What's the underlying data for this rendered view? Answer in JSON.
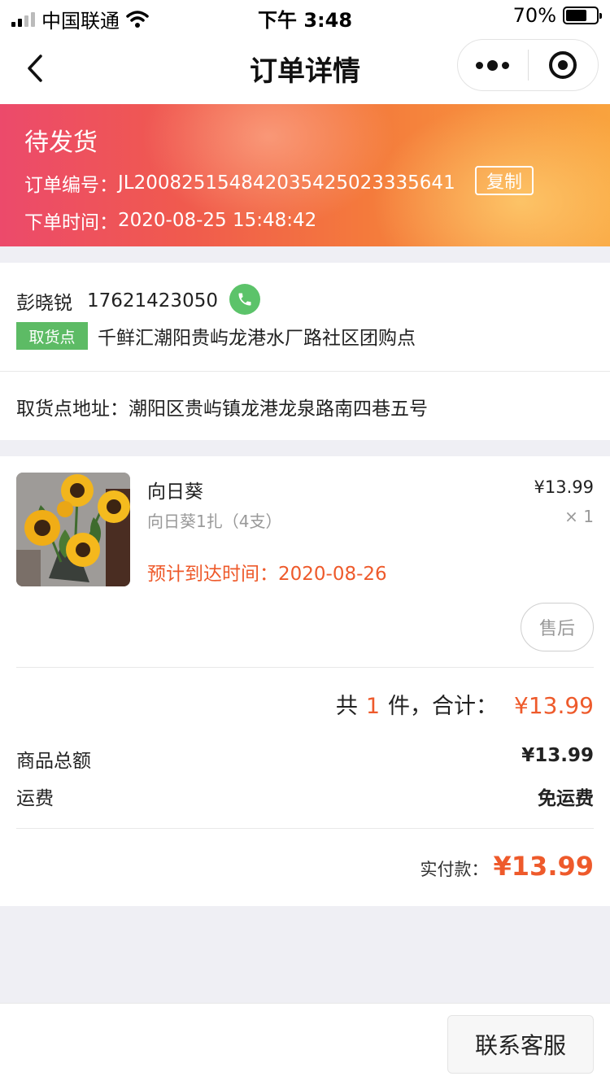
{
  "status_bar": {
    "carrier": "中国联通",
    "time": "下午 3:48",
    "battery_text": "70%",
    "battery_level": 0.7
  },
  "nav": {
    "title": "订单详情",
    "back_icon": "chevron-left-icon",
    "more_icon": "more-dots-icon",
    "close_icon": "target-circle-icon"
  },
  "banner": {
    "status": "待发货",
    "order_no_label": "订单编号：",
    "order_no": "JL20082515484203542502333​5641",
    "copy_label": "复制",
    "order_time_label": "下单时间：",
    "order_time": "2020-08-25 15:48:42",
    "colors": {
      "start": "#ec4a6b",
      "end": "#f9a33e"
    }
  },
  "contact": {
    "name": "彭晓锐",
    "phone": "17621423050",
    "phone_icon": "phone-icon",
    "pickup_tag": "取货点",
    "pickup_name": "千鲜汇潮阳贵屿龙港水厂路社区团购点",
    "address_label": "取货点地址：",
    "address": "潮阳区贵屿镇龙港龙泉路南四巷五号"
  },
  "product": {
    "name": "向日葵",
    "spec": "向日葵1扎（4支）",
    "price": "¥13.99",
    "qty": "× 1",
    "eta_label": "预计到达时间：",
    "eta": "2020-08-26",
    "after_sale_label": "售后",
    "image_icon": "sunflower-image"
  },
  "summary": {
    "count_prefix": "共",
    "count": "1",
    "count_suffix": "件，合计：",
    "total": "¥13.99",
    "subtotal_label": "商品总额",
    "subtotal": "¥13.99",
    "shipping_label": "运费",
    "shipping": "免运费",
    "paid_label": "实付款：",
    "paid": "¥13.99"
  },
  "bottom": {
    "service_label": "联系客服"
  },
  "colors": {
    "accent": "#ee5a2b",
    "pickup_green": "#5dbb65",
    "phone_green": "#5cc36a"
  }
}
